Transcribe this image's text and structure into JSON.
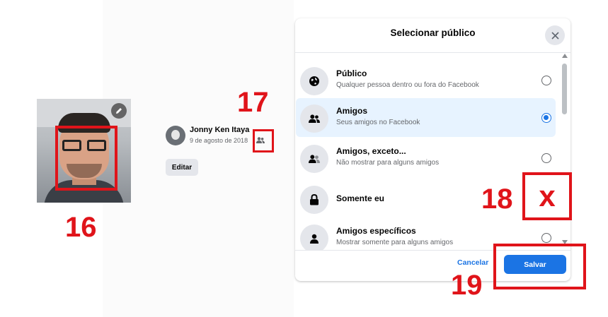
{
  "annotations": {
    "n16": "16",
    "n17": "17",
    "n18": "18",
    "n19": "19",
    "x_mark": "x",
    "color": "#e0141a"
  },
  "post": {
    "author": "Jonny Ken Itaya",
    "date": "9 de agosto de 2018",
    "audience_icon": "friends-icon",
    "edit_label": "Editar"
  },
  "photo": {
    "edit_icon": "pencil-icon"
  },
  "dialog": {
    "title": "Selecionar público",
    "close_icon": "close-icon",
    "options": [
      {
        "title": "Público",
        "desc": "Qualquer pessoa dentro ou fora do Facebook",
        "icon": "globe-icon",
        "selected": false
      },
      {
        "title": "Amigos",
        "desc": "Seus amigos no Facebook",
        "icon": "friends-icon",
        "selected": true
      },
      {
        "title": "Amigos, exceto...",
        "desc": "Não mostrar para alguns amigos",
        "icon": "friends-except-icon",
        "selected": false
      },
      {
        "title": "Somente eu",
        "desc": "",
        "icon": "lock-icon",
        "selected": false
      },
      {
        "title": "Amigos específicos",
        "desc": "Mostrar somente para alguns amigos",
        "icon": "person-icon",
        "selected": false
      }
    ],
    "cancel_label": "Cancelar",
    "save_label": "Salvar",
    "accent": "#1b74e4"
  }
}
